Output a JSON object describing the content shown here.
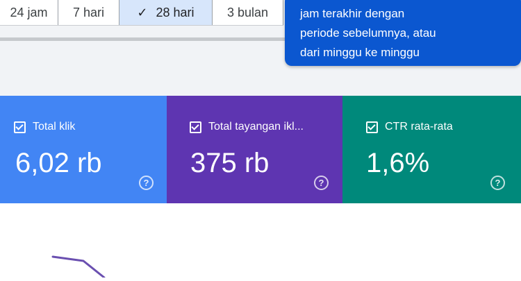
{
  "date_range": {
    "options": [
      {
        "label": "24 jam",
        "selected": false
      },
      {
        "label": "7 hari",
        "selected": false
      },
      {
        "label": "28 hari",
        "selected": true
      },
      {
        "label": "3 bulan",
        "selected": false
      }
    ]
  },
  "tooltip": {
    "lines": [
      "jam terakhir dengan",
      "periode sebelumnya, atau",
      "dari minggu ke minggu"
    ]
  },
  "metrics": [
    {
      "label": "Total klik",
      "value": "6,02 rb",
      "color": "#4285f4",
      "checked": true
    },
    {
      "label": "Total tayangan ikl...",
      "value": "375 rb",
      "color": "#5e35b1",
      "checked": true
    },
    {
      "label": "CTR rata-rata",
      "value": "1,6%",
      "color": "#00897b",
      "checked": true
    }
  ],
  "icons": {
    "check": "✓",
    "help": "?"
  },
  "colors": {
    "tooltip_bg": "#0b57d0",
    "selected_option_bg": "#d7e6fb",
    "chart_line": "#6a4fb0"
  }
}
